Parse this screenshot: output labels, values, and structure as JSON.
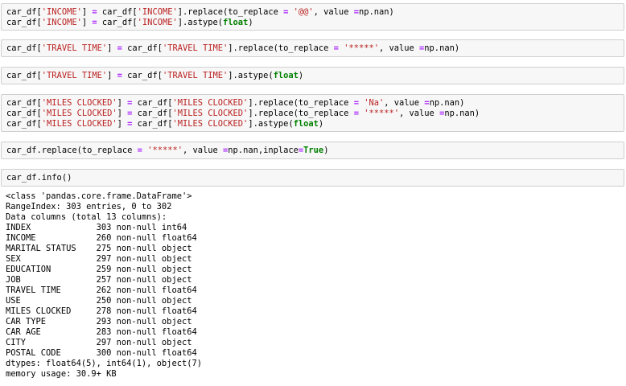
{
  "cells": [
    {
      "lines": [
        [
          {
            "t": "car_df[",
            "c": ""
          },
          {
            "t": "'INCOME'",
            "c": "str"
          },
          {
            "t": "] ",
            "c": ""
          },
          {
            "t": "=",
            "c": "op"
          },
          {
            "t": " car_df[",
            "c": ""
          },
          {
            "t": "'INCOME'",
            "c": "str"
          },
          {
            "t": "].replace(to_replace ",
            "c": ""
          },
          {
            "t": "=",
            "c": "op"
          },
          {
            "t": " ",
            "c": ""
          },
          {
            "t": "'@@'",
            "c": "str"
          },
          {
            "t": ", value ",
            "c": ""
          },
          {
            "t": "=",
            "c": "op"
          },
          {
            "t": "np.nan)",
            "c": ""
          }
        ],
        [
          {
            "t": "car_df[",
            "c": ""
          },
          {
            "t": "'INCOME'",
            "c": "str"
          },
          {
            "t": "] ",
            "c": ""
          },
          {
            "t": "=",
            "c": "op"
          },
          {
            "t": " car_df[",
            "c": ""
          },
          {
            "t": "'INCOME'",
            "c": "str"
          },
          {
            "t": "].astype(",
            "c": ""
          },
          {
            "t": "float",
            "c": "kw"
          },
          {
            "t": ")",
            "c": ""
          }
        ]
      ]
    },
    {
      "lines": [
        [
          {
            "t": "car_df[",
            "c": ""
          },
          {
            "t": "'TRAVEL TIME'",
            "c": "str"
          },
          {
            "t": "] ",
            "c": ""
          },
          {
            "t": "=",
            "c": "op"
          },
          {
            "t": " car_df[",
            "c": ""
          },
          {
            "t": "'TRAVEL TIME'",
            "c": "str"
          },
          {
            "t": "].replace(to_replace ",
            "c": ""
          },
          {
            "t": "=",
            "c": "op"
          },
          {
            "t": " ",
            "c": ""
          },
          {
            "t": "'*****'",
            "c": "str"
          },
          {
            "t": ", value ",
            "c": ""
          },
          {
            "t": "=",
            "c": "op"
          },
          {
            "t": "np.nan)",
            "c": ""
          }
        ]
      ]
    },
    {
      "lines": [
        [
          {
            "t": "car_df[",
            "c": ""
          },
          {
            "t": "'TRAVEL TIME'",
            "c": "str"
          },
          {
            "t": "] ",
            "c": ""
          },
          {
            "t": "=",
            "c": "op"
          },
          {
            "t": " car_df[",
            "c": ""
          },
          {
            "t": "'TRAVEL TIME'",
            "c": "str"
          },
          {
            "t": "].astype(",
            "c": ""
          },
          {
            "t": "float",
            "c": "kw"
          },
          {
            "t": ")",
            "c": ""
          }
        ]
      ]
    },
    {
      "lines": [
        [
          {
            "t": "car_df[",
            "c": ""
          },
          {
            "t": "'MILES CLOCKED'",
            "c": "str"
          },
          {
            "t": "] ",
            "c": ""
          },
          {
            "t": "=",
            "c": "op"
          },
          {
            "t": " car_df[",
            "c": ""
          },
          {
            "t": "'MILES CLOCKED'",
            "c": "str"
          },
          {
            "t": "].replace(to_replace ",
            "c": ""
          },
          {
            "t": "=",
            "c": "op"
          },
          {
            "t": " ",
            "c": ""
          },
          {
            "t": "'Na'",
            "c": "str"
          },
          {
            "t": ", value ",
            "c": ""
          },
          {
            "t": "=",
            "c": "op"
          },
          {
            "t": "np.nan)",
            "c": ""
          }
        ],
        [
          {
            "t": "car_df[",
            "c": ""
          },
          {
            "t": "'MILES CLOCKED'",
            "c": "str"
          },
          {
            "t": "] ",
            "c": ""
          },
          {
            "t": "=",
            "c": "op"
          },
          {
            "t": " car_df[",
            "c": ""
          },
          {
            "t": "'MILES CLOCKED'",
            "c": "str"
          },
          {
            "t": "].replace(to_replace ",
            "c": ""
          },
          {
            "t": "=",
            "c": "op"
          },
          {
            "t": " ",
            "c": ""
          },
          {
            "t": "'*****'",
            "c": "str"
          },
          {
            "t": ", value ",
            "c": ""
          },
          {
            "t": "=",
            "c": "op"
          },
          {
            "t": "np.nan)",
            "c": ""
          }
        ],
        [
          {
            "t": "car_df[",
            "c": ""
          },
          {
            "t": "'MILES CLOCKED'",
            "c": "str"
          },
          {
            "t": "] ",
            "c": ""
          },
          {
            "t": "=",
            "c": "op"
          },
          {
            "t": " car_df[",
            "c": ""
          },
          {
            "t": "'MILES CLOCKED'",
            "c": "str"
          },
          {
            "t": "].astype(",
            "c": ""
          },
          {
            "t": "float",
            "c": "kw"
          },
          {
            "t": ")",
            "c": ""
          }
        ]
      ]
    },
    {
      "lines": [
        [
          {
            "t": "car_df.replace(to_replace ",
            "c": ""
          },
          {
            "t": "=",
            "c": "op"
          },
          {
            "t": " ",
            "c": ""
          },
          {
            "t": "'*****'",
            "c": "str"
          },
          {
            "t": ", value ",
            "c": ""
          },
          {
            "t": "=",
            "c": "op"
          },
          {
            "t": "np.nan,inplace",
            "c": ""
          },
          {
            "t": "=",
            "c": "op"
          },
          {
            "t": "True",
            "c": "kw"
          },
          {
            "t": ")",
            "c": ""
          }
        ]
      ]
    },
    {
      "lines": [
        [
          {
            "t": "car_df.info()",
            "c": ""
          }
        ]
      ]
    }
  ],
  "output": {
    "lines": [
      "<class 'pandas.core.frame.DataFrame'>",
      "RangeIndex: 303 entries, 0 to 302",
      "Data columns (total 13 columns):",
      "INDEX             303 non-null int64",
      "INCOME            260 non-null float64",
      "MARITAL STATUS    275 non-null object",
      "SEX               297 non-null object",
      "EDUCATION         259 non-null object",
      "JOB               257 non-null object",
      "TRAVEL TIME       262 non-null float64",
      "USE               250 non-null object",
      "MILES CLOCKED     278 non-null float64",
      "CAR TYPE          293 non-null object",
      "CAR AGE           283 non-null float64",
      "CITY              297 non-null object",
      "POSTAL CODE       300 non-null float64",
      "dtypes: float64(5), int64(1), object(7)",
      "memory usage: 30.9+ KB"
    ]
  },
  "colors": {
    "string": "#ba2121",
    "keyword": "#008000",
    "operator": "#aa22ff",
    "cell_background": "#f7f7f7",
    "cell_border": "#cfcfcf"
  }
}
